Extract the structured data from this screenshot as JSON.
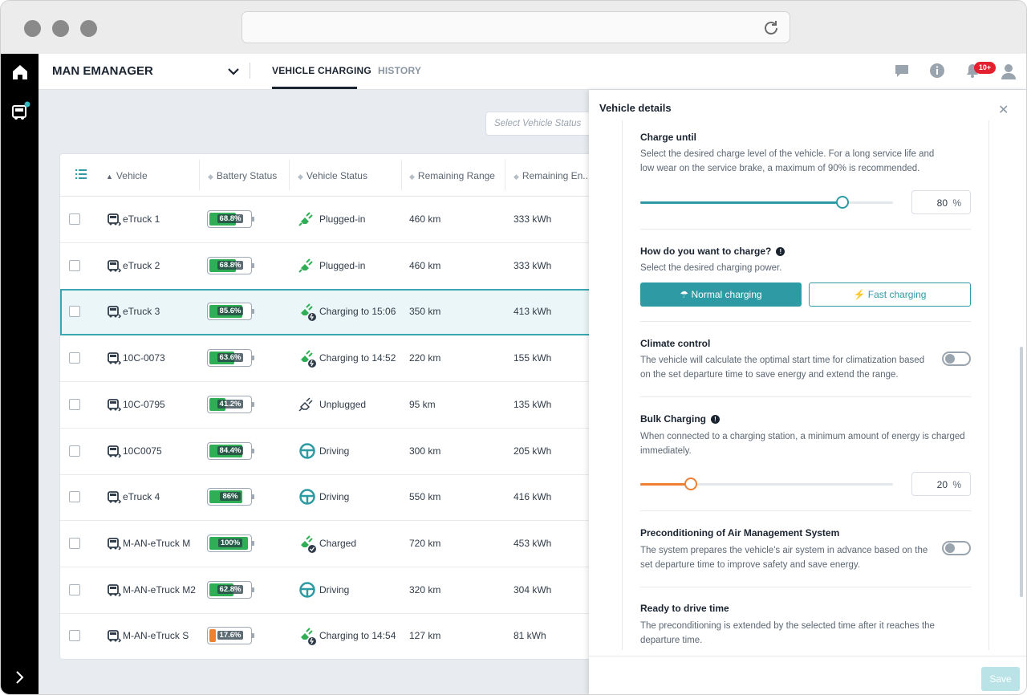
{
  "app": {
    "brand": "MAN EMANAGER",
    "notifications_badge": "10+",
    "accent": "#2e9aa3"
  },
  "tabs": [
    {
      "label": "VEHICLE CHARGING",
      "active": true
    },
    {
      "label": "HISTORY",
      "active": false
    }
  ],
  "filter": {
    "placeholder": "Select Vehicle Status"
  },
  "table": {
    "columns": [
      "Vehicle",
      "Battery Status",
      "Vehicle Status",
      "Remaining Range",
      "Remaining En..."
    ],
    "rows": [
      {
        "vehicle": "eTruck 1",
        "battery": "68.8%",
        "battery_level": 0.688,
        "status": "Plugged-in",
        "status_icon": "plug-icon",
        "range": "460 km",
        "energy": "333 kWh"
      },
      {
        "vehicle": "eTruck 2",
        "battery": "68.8%",
        "battery_level": 0.688,
        "status": "Plugged-in",
        "status_icon": "plug-icon",
        "range": "460 km",
        "energy": "333 kWh"
      },
      {
        "vehicle": "eTruck 3",
        "battery": "85.6%",
        "battery_level": 0.856,
        "status": "Charging to 15:06",
        "status_icon": "charging-plug-icon",
        "range": "350 km",
        "energy": "413 kWh",
        "selected": true
      },
      {
        "vehicle": "10C-0073",
        "battery": "63.6%",
        "battery_level": 0.636,
        "status": "Charging to 14:52",
        "status_icon": "charging-plug-icon",
        "range": "220 km",
        "energy": "155 kWh"
      },
      {
        "vehicle": "10C-0795",
        "battery": "41.2%",
        "battery_level": 0.412,
        "status": "Unplugged",
        "status_icon": "unplugged-icon",
        "range": "95 km",
        "energy": "135 kWh"
      },
      {
        "vehicle": "10C0075",
        "battery": "84.4%",
        "battery_level": 0.844,
        "status": "Driving",
        "status_icon": "steering-wheel-icon",
        "range": "300 km",
        "energy": "205 kWh"
      },
      {
        "vehicle": "eTruck 4",
        "battery": "86%",
        "battery_level": 0.86,
        "status": "Driving",
        "status_icon": "steering-wheel-icon",
        "range": "550 km",
        "energy": "416 kWh"
      },
      {
        "vehicle": "M-AN-eTruck M",
        "battery": "100%",
        "battery_level": 1.0,
        "status": "Charged",
        "status_icon": "charged-plug-icon",
        "range": "720 km",
        "energy": "453 kWh"
      },
      {
        "vehicle": "M-AN-eTruck M2",
        "battery": "62.8%",
        "battery_level": 0.628,
        "status": "Driving",
        "status_icon": "steering-wheel-icon",
        "range": "320 km",
        "energy": "304 kWh"
      },
      {
        "vehicle": "M-AN-eTruck S",
        "battery": "17.6%",
        "battery_level": 0.176,
        "status": "Charging to 14:54",
        "status_icon": "charging-plug-icon",
        "range": "127 km",
        "energy": "81 kWh",
        "low": true
      }
    ]
  },
  "panel": {
    "title": "Vehicle details",
    "charge_until": {
      "title": "Charge until",
      "desc": "Select the desired charge level of the vehicle. For a long service life and low wear on the service brake, a maximum of 90% is recommended.",
      "value": "80",
      "unit": "%",
      "level": 0.8
    },
    "how_charge": {
      "title": "How do you want to charge?",
      "desc": "Select the desired charging power.",
      "normal": "Normal charging",
      "fast": "Fast charging"
    },
    "climate": {
      "title": "Climate control",
      "desc": "The vehicle will calculate the optimal start time for climatization based on the set departure time to save energy and extend the range.",
      "on": false
    },
    "bulk": {
      "title": "Bulk Charging",
      "desc": "When connected to a charging station, a minimum amount of energy is charged immediately.",
      "value": "20",
      "unit": "%",
      "level": 0.2
    },
    "precond": {
      "title": "Preconditioning of Air Management System",
      "desc": "The system prepares the vehicle's air system in advance based on the set departure time to improve safety and save energy.",
      "on": false
    },
    "ready": {
      "title": "Ready to drive time",
      "desc": "The preconditioning is extended by the selected time after it reaches the departure time."
    },
    "save": "Save"
  }
}
